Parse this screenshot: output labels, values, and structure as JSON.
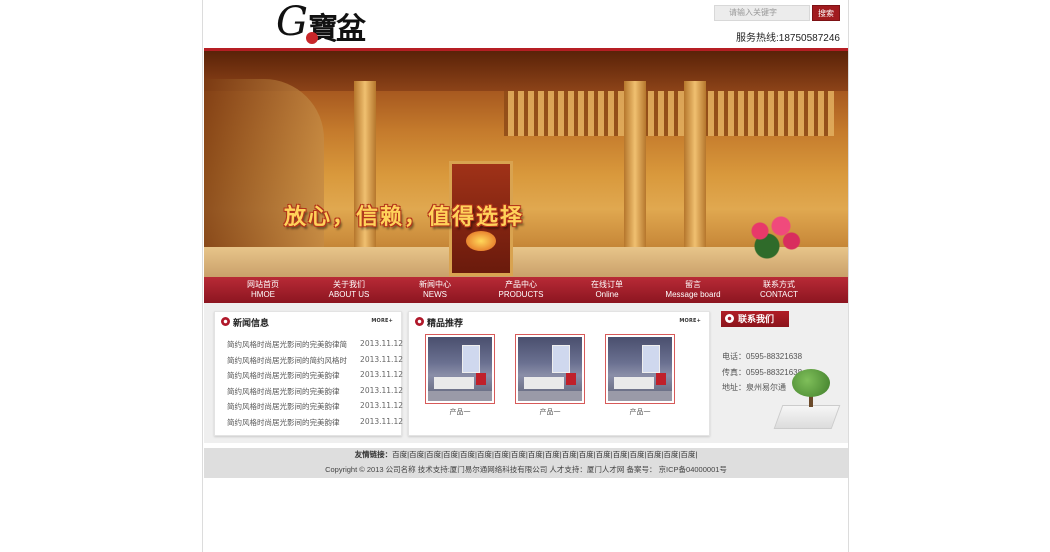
{
  "header": {
    "logo_letter": "G",
    "logo_text": "寶盆",
    "search_placeholder": "请输入关键字",
    "search_button": "搜索",
    "hotline": "服务热线:18750587246"
  },
  "banner": {
    "slogan": "放心，信赖，值得选择"
  },
  "nav": [
    {
      "cn": "网站首页",
      "en": "HMOE"
    },
    {
      "cn": "关于我们",
      "en": "ABOUT US"
    },
    {
      "cn": "新闻中心",
      "en": "NEWS"
    },
    {
      "cn": "产品中心",
      "en": "PRODUCTS"
    },
    {
      "cn": "在线订单",
      "en": "Online"
    },
    {
      "cn": "留言",
      "en": "Message board"
    },
    {
      "cn": "联系方式",
      "en": "CONTACT"
    }
  ],
  "news": {
    "title": "新闻信息",
    "more": "MORE+",
    "items": [
      {
        "title": "简约风格时尚居光影间的完美韵律简",
        "date": "2013.11.12"
      },
      {
        "title": "简约风格时尚居光影间的简约风格时",
        "date": "2013.11.12"
      },
      {
        "title": "简约风格时尚居光影间的完美韵律",
        "date": "2013.11.12"
      },
      {
        "title": "简约风格时尚居光影间的完美韵律",
        "date": "2013.11.12"
      },
      {
        "title": "简约风格时尚居光影间的完美韵律",
        "date": "2013.11.12"
      },
      {
        "title": "简约风格时尚居光影间的完美韵律",
        "date": "2013.11.12"
      }
    ]
  },
  "products": {
    "title": "精品推荐",
    "more": "MORE+",
    "items": [
      {
        "label": "产品一"
      },
      {
        "label": "产品一"
      },
      {
        "label": "产品一"
      }
    ]
  },
  "contact": {
    "title": "联系我们",
    "phone": "电话：0595-88321638",
    "fax": "传真：0595-88321638",
    "address": "地址：泉州易尔通"
  },
  "footer": {
    "friend_label": "友情链接：",
    "friend_links": [
      "百度",
      "百度",
      "百度",
      "百度",
      "百度",
      "百度",
      "百度",
      "百度",
      "百度",
      "百度",
      "百度",
      "百度",
      "百度",
      "百度",
      "百度",
      "百度",
      "百度",
      "百度"
    ],
    "copyright": "Copyright © 2013 公司名称 技术支持:厦门易尔通网络科技有限公司 人才支持：厦门人才网 备案号： 京ICP备04000001号"
  }
}
